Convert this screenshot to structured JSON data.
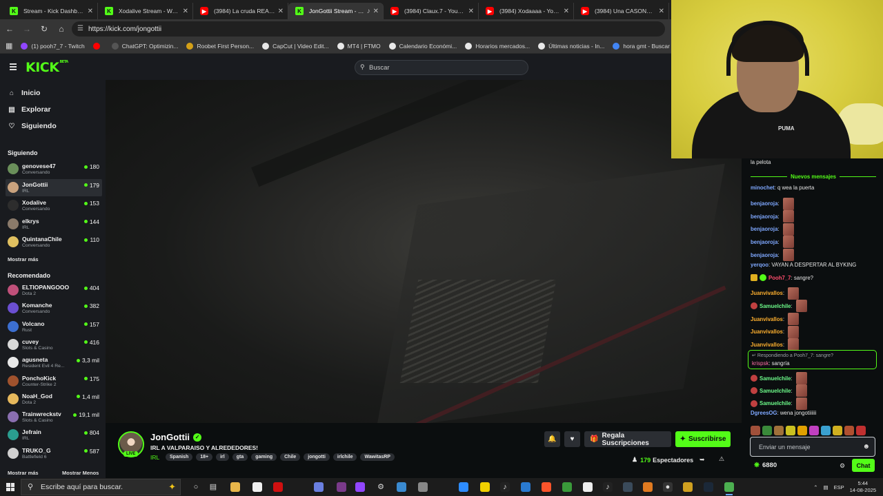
{
  "browser": {
    "tabs": [
      {
        "title": "Stream - Kick Dashboard",
        "icon": "kick",
        "active": false
      },
      {
        "title": "Xodalive Stream - Watch L",
        "icon": "kick",
        "active": false
      },
      {
        "title": "(3984) La cruda REALIDAD",
        "icon": "yt",
        "active": false
      },
      {
        "title": "JonGottii Stream - Wa",
        "icon": "kick",
        "active": true
      },
      {
        "title": "(3984) Claux.7 - YouTube",
        "icon": "yt",
        "active": false
      },
      {
        "title": "(3984) Xodaaaa - YouTube",
        "icon": "yt",
        "active": false
      },
      {
        "title": "(3984) Una CASONA EMB",
        "icon": "yt",
        "active": false
      }
    ],
    "url": "https://kick.com/jongottii",
    "bookmarks": [
      {
        "label": "(1) pooh7_7 - Twitch",
        "color": "#9146ff"
      },
      {
        "label": "",
        "color": "#ff0000"
      },
      {
        "label": "ChatGPT: Optimizin...",
        "color": "#555555"
      },
      {
        "label": "Roobet First Person...",
        "color": "#d4a017"
      },
      {
        "label": "CapCut | Video Edit...",
        "color": "#e8e8e8"
      },
      {
        "label": "MT4 | FTMO",
        "color": "#e8e8e8"
      },
      {
        "label": "Calendario Económi...",
        "color": "#e8e8e8"
      },
      {
        "label": "Horarios mercados...",
        "color": "#e8e8e8"
      },
      {
        "label": "Últimas noticias - In...",
        "color": "#e8e8e8"
      },
      {
        "label": "hora gmt - Buscar c...",
        "color": "#4285f4"
      },
      {
        "label": "FTM",
        "color": "#e8e8e8"
      }
    ]
  },
  "kick": {
    "logo": "KICK",
    "logo_sup": "BETA",
    "search_placeholder": "Buscar",
    "nav": [
      {
        "label": "Inicio",
        "icon": "home-icon"
      },
      {
        "label": "Explorar",
        "icon": "explore-icon"
      },
      {
        "label": "Siguiendo",
        "icon": "heart-icon"
      }
    ],
    "following_heading": "Siguiendo",
    "following": [
      {
        "name": "genovese47",
        "category": "Conversando",
        "viewers": "180",
        "color": "#6a8f5a"
      },
      {
        "name": "JonGottii",
        "category": "IRL",
        "viewers": "179",
        "color": "#c9a27e",
        "selected": true
      },
      {
        "name": "Xodalive",
        "category": "Conversando",
        "viewers": "153",
        "color": "#2d2d2d"
      },
      {
        "name": "elkrys",
        "category": "IRL",
        "viewers": "144",
        "color": "#8a7a6a"
      },
      {
        "name": "QuintanaChile",
        "category": "Conversando",
        "viewers": "110",
        "color": "#e0c060"
      }
    ],
    "show_more": "Mostrar más",
    "recommended_heading": "Recomendado",
    "recommended": [
      {
        "name": "ELTIOPANGOOO",
        "category": "Dota 2",
        "viewers": "404",
        "color": "#c0507a"
      },
      {
        "name": "Komanche",
        "category": "Conversando",
        "viewers": "382",
        "color": "#6b4fd1"
      },
      {
        "name": "Volcano",
        "category": "Rust",
        "viewers": "157",
        "color": "#3c6fd0"
      },
      {
        "name": "cuvey",
        "category": "Slots & Casino",
        "viewers": "416",
        "color": "#d8d8d8"
      },
      {
        "name": "agusneta",
        "category": "Resident Evil 4 Re...",
        "viewers": "3,3 mil",
        "color": "#e8e8e8"
      },
      {
        "name": "PonchoKick",
        "category": "Counter-Strike 2",
        "viewers": "175",
        "color": "#a0522d"
      },
      {
        "name": "NoaH_God",
        "category": "Dota 2",
        "viewers": "1,4 mil",
        "color": "#e6b85c"
      },
      {
        "name": "Trainwreckstv",
        "category": "Slots & Casino",
        "viewers": "19,1 mil",
        "color": "#8a6fb0"
      },
      {
        "name": "Jefrain",
        "category": "IRL",
        "viewers": "804",
        "color": "#2a9d8f"
      },
      {
        "name": "TRUKO_G",
        "category": "Battlefield 6",
        "viewers": "587",
        "color": "#d0d0d0"
      }
    ],
    "show_more_bottom": "Mostrar más",
    "show_less": "Mostrar Menos"
  },
  "stream": {
    "streamer": "JonGottii",
    "live_label": "LIVE",
    "title": "IRL A VALPARAISO Y ALREDEDORES!",
    "category": "IRL",
    "tags": [
      "Spanish",
      "18+",
      "irl",
      "gta",
      "gaming",
      "Chile",
      "jongotti",
      "irlchile",
      "WawitasRP"
    ],
    "gift_label": "Regala Suscripciones",
    "subscribe_label": "Suscribirse",
    "viewer_count": "179",
    "viewer_label": "Espectadores"
  },
  "webcam": {
    "brand_text": "PUMA"
  },
  "chat": {
    "partial_top": "la pelota",
    "new_messages": "Nuevos mensajes",
    "messages": [
      {
        "user": "minochet",
        "text": "q wea la puerta",
        "color": "#7fa8ff",
        "emote": false
      },
      {
        "user": "benjaoroja",
        "text": "",
        "color": "#7fa8ff",
        "emote": true
      },
      {
        "user": "benjaoroja",
        "text": "",
        "color": "#7fa8ff",
        "emote": true
      },
      {
        "user": "benjaoroja",
        "text": "",
        "color": "#7fa8ff",
        "emote": true
      },
      {
        "user": "benjaoroja",
        "text": "",
        "color": "#7fa8ff",
        "emote": true
      },
      {
        "user": "benjaoroja",
        "text": "",
        "color": "#7fa8ff",
        "emote": true
      },
      {
        "user": "yerqoo",
        "text": "VAYAN A DESPERTAR AL BYKING",
        "color": "#7fa8ff",
        "emote": false
      },
      {
        "user": "Pooh7_7",
        "text": "sangre?",
        "color": "#ff4d6d",
        "emote": false,
        "badges": true
      },
      {
        "user": "Juanvivallos",
        "text": "",
        "color": "#ffb02e",
        "emote": true
      },
      {
        "user": "Samuelchile",
        "text": "",
        "color": "#6dfc8a",
        "emote": true,
        "badge": true
      },
      {
        "user": "Juanvivallos",
        "text": "",
        "color": "#ffb02e",
        "emote": true
      },
      {
        "user": "Juanvivallos",
        "text": "",
        "color": "#ffb02e",
        "emote": true
      },
      {
        "user": "Juanvivallos",
        "text": "",
        "color": "#ffb02e",
        "emote": true
      }
    ],
    "reply": {
      "context": "Respondiendo a Pooh7_7: sangre?",
      "user": "krispsk",
      "text": "sangría",
      "color": "#ff6fa8"
    },
    "messages_after": [
      {
        "user": "Samuelchile",
        "text": "",
        "color": "#6dfc8a",
        "emote": true,
        "badge": true
      },
      {
        "user": "Samuelchile",
        "text": "",
        "color": "#6dfc8a",
        "emote": true,
        "badge": true
      },
      {
        "user": "Samuelchile",
        "text": "",
        "color": "#6dfc8a",
        "emote": true,
        "badge": true
      },
      {
        "user": "DgreesOG",
        "text": "wena jongotiiiiii",
        "color": "#7fa8ff",
        "emote": false
      }
    ],
    "input_placeholder": "Enviar un mensaje",
    "points": "6880",
    "send_label": "Chat"
  },
  "taskbar": {
    "search_placeholder": "Escribe aquí para buscar.",
    "language": "ESP",
    "time": "5:44",
    "date": "14-08-2025"
  }
}
